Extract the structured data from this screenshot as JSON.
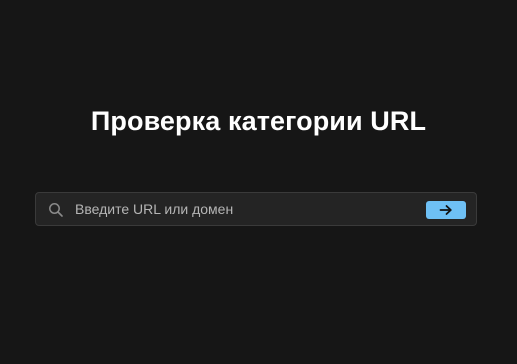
{
  "page": {
    "title": "Проверка категории URL"
  },
  "search": {
    "placeholder": "Введите URL или домен",
    "value": "",
    "icon": "search-icon",
    "submit_icon": "arrow-right-icon",
    "accent_color": "#6ec0f5"
  }
}
